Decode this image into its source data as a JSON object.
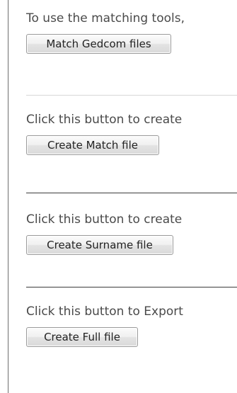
{
  "sections": [
    {
      "instruction": "To use the matching tools,",
      "button_label": "Match Gedcom files"
    },
    {
      "instruction": "Click this button to create",
      "button_label": "Create Match file"
    },
    {
      "instruction": "Click this button to create",
      "button_label": "Create Surname file"
    },
    {
      "instruction": "Click this button to Export",
      "button_label": "Create Full file"
    }
  ]
}
